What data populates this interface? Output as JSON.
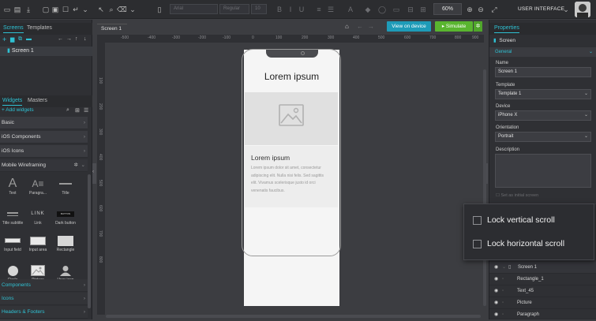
{
  "toolbar": {
    "font_family": "Arial",
    "font_weight": "Regular",
    "font_size": "10",
    "zoom": "60%",
    "mode_label": "USER INTERFACE"
  },
  "left_panel": {
    "tabs": [
      "Screens",
      "Templates"
    ],
    "screens": [
      "Screen 1"
    ],
    "widget_tabs": [
      "Widgets",
      "Masters"
    ],
    "add_widgets": "Add widgets",
    "categories_top": [
      "Basic",
      "iOS Components",
      "iOS Icons",
      "Mobile Wireframing"
    ],
    "widgets": [
      {
        "label": "Text"
      },
      {
        "label": "Paragra..."
      },
      {
        "label": "Title"
      },
      {
        "label": "Title subtitle"
      },
      {
        "label": "Link"
      },
      {
        "label": "Dark button"
      },
      {
        "label": "Input field"
      },
      {
        "label": "Input area"
      },
      {
        "label": "Rectangle"
      },
      {
        "label": "Circle"
      },
      {
        "label": "Picture"
      },
      {
        "label": "User icon"
      }
    ],
    "widget_link_text": "LINK",
    "widget_button_text": "BUTTON",
    "categories_bottom": [
      "Components",
      "Icons",
      "Headers & Footers"
    ]
  },
  "canvas": {
    "doc_tab": "Screen 1",
    "view_on_device": "View on device",
    "simulate": "Simulate",
    "ruler_top": [
      "-500",
      "-400",
      "-300",
      "-200",
      "-100",
      "0",
      "100",
      "200",
      "300",
      "400",
      "500",
      "600",
      "700",
      "800",
      "900"
    ],
    "ruler_left": [
      "100",
      "200",
      "300",
      "400",
      "500",
      "600",
      "700",
      "800"
    ],
    "phone": {
      "title": "Lorem ipsum",
      "heading": "Lorem ipsum",
      "paragraph": "Lorem ipsum dolor sit amet, consectetur adipiscing elit. Nulla nisi felis. Sed sagittis elit. Vivamus scelerisque justo id orci venenatis faucibus."
    }
  },
  "right_panel": {
    "tab": "Properties",
    "object": "Screen",
    "section": "General",
    "name_label": "Name",
    "name_value": "Screen 1",
    "template_label": "Template",
    "template_value": "Template 1",
    "device_label": "Device",
    "device_value": "iPhone X",
    "orientation_label": "Orientation",
    "orientation_value": "Portrait",
    "description_label": "Description",
    "initial_screen": "Set as initial screen"
  },
  "popup": {
    "lock_vertical": "Lock vertical scroll",
    "lock_horizontal": "Lock horizontal scroll"
  },
  "layers": [
    "Screen 1",
    "Rectangle_1",
    "Text_45",
    "Picture",
    "Paragraph"
  ],
  "colors": {
    "accent": "#2fc1d3",
    "view_button": "#1e9bb8",
    "simulate_button": "#59b52f"
  }
}
